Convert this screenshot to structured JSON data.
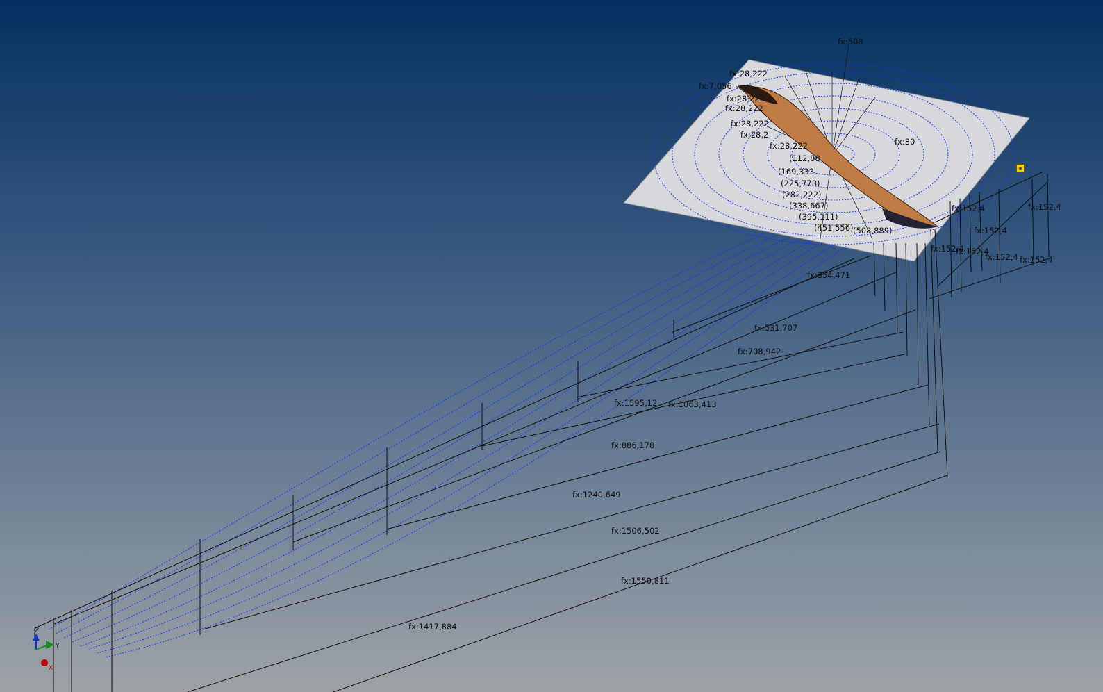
{
  "viewport": {
    "background_top": "#04305f",
    "background_bottom": "#9ea2a6",
    "plane_color": "#d7d8dc",
    "blade_color": "#c07b45",
    "curve_color": "#1a2cff",
    "dimension_color": "#111111"
  },
  "dimensions": {
    "d508": "fx:508",
    "d28_222_a": "fx:28,222",
    "d7_056": "fx:7,056",
    "d28_222_b": "fx:28,222",
    "d28_222_c": "fx:28,222",
    "d28_222_d": "fx:28,222",
    "d28_222_e": "fx:28,2",
    "d28_222_f": "fx:28,222",
    "d30": "fx:30",
    "d152_4_a": "fx:152,4",
    "d152_4_b": "fx:152,4",
    "d152_4_c": "fx:152,4",
    "d152_4_d": "fx:152,4",
    "d152_4_e": "fx:152,4",
    "d152_4_f": "fx:152,4",
    "d152_4_g": "fx:152,4",
    "d354": "fx:354,471",
    "d531": "fx:531,707",
    "d708": "fx:708,942",
    "d1595": "fx:1595,12",
    "d1063": "fx:1063,413",
    "d886": "fx:886,178",
    "d1240": "fx:1240,649",
    "d1506": "fx:1506,502",
    "d1550": "fx:1550,811",
    "d1417": "fx:1417,884"
  },
  "radii": {
    "r112": "(112,88",
    "r169": "(169,333",
    "r225": "(225,778)",
    "r282": "(282,222)",
    "r338": "(338,667)",
    "r395": "(395,111)",
    "r451": "(451,556)",
    "r508": "(508,889)"
  },
  "triad": {
    "z": "Z",
    "y": "Y",
    "x": "X"
  }
}
